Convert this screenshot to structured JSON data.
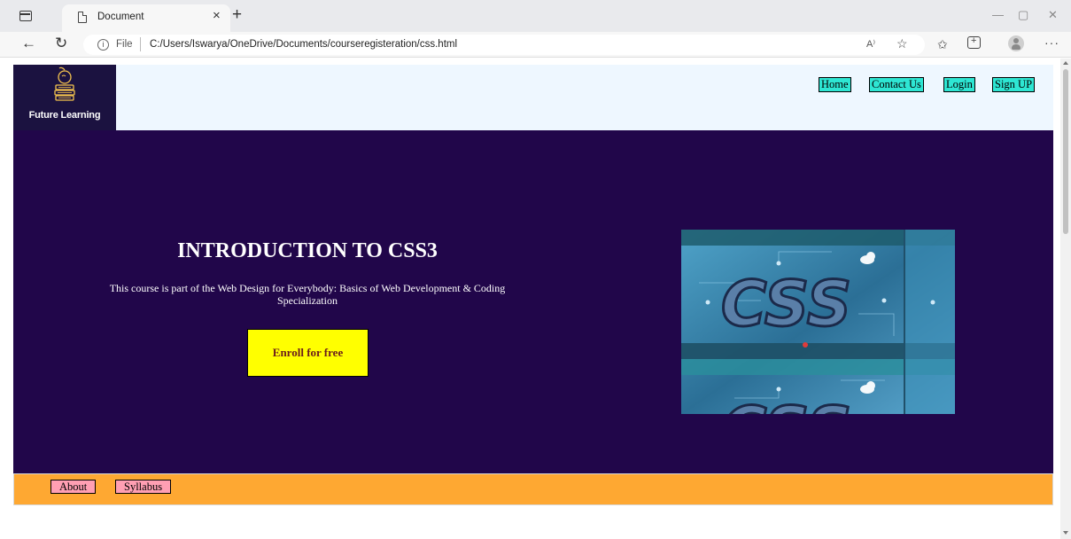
{
  "browser": {
    "tab_title": "Document",
    "tab_close": "×",
    "new_tab": "+",
    "window_controls": {
      "minimize": "—",
      "maximize": "▢",
      "close": "✕"
    },
    "back": "←",
    "reload": "↻",
    "info": "i",
    "file_label": "File",
    "url": "C:/Users/Iswarya/OneDrive/Documents/courseregisteration/css.html",
    "read_aloud": "A⁾",
    "favorite": "☆",
    "favorites_bar": "✩",
    "more": "···"
  },
  "site": {
    "logo_text": "Future Learning",
    "nav": [
      "Home",
      "Contact Us",
      "Login",
      "Sign UP"
    ]
  },
  "hero": {
    "title": "INTRODUCTION TO CSS3",
    "description": "This course is part of the Web Design for Everybody: Basics of Web Development & Coding Specialization",
    "enroll_label": "Enroll for free",
    "image_text": "CSS",
    "image_alt": "css"
  },
  "footer": {
    "links": [
      "About",
      "Syllabus"
    ]
  },
  "colors": {
    "hero_bg": "#21064a",
    "header_bg": "#eef7ff",
    "logo_bg": "#1b1240",
    "nav_btn": "#2ee6d3",
    "enroll_btn": "#ffff00",
    "footer_bg": "#fea832",
    "footer_btn": "#ff9fb3"
  }
}
